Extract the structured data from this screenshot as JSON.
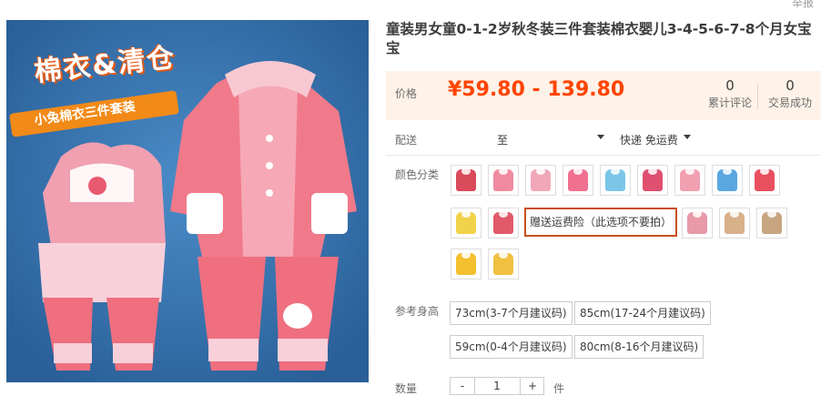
{
  "top_link": "举报",
  "image": {
    "banner_title": "棉衣&清仓",
    "banner_sub": "小兔棉衣三件套装"
  },
  "product_title": "童装男女童0-1-2岁秋冬装三件套装棉衣婴儿3-4-5-6-7-8个月女宝宝",
  "price": {
    "label": "价格",
    "value": "¥59.80 - 139.80",
    "reviews_count": "0",
    "reviews_label": "累计评论",
    "sales_count": "0",
    "sales_label": "交易成功"
  },
  "shipping": {
    "label": "配送",
    "to": "至",
    "method": "快递 免运费"
  },
  "colors": {
    "label": "颜色分类",
    "swatch_colors": [
      "#d94a5a",
      "#f08aa0",
      "#f0a8b8",
      "#f07090",
      "#7bc6e8",
      "#e05070",
      "#f0a0b0",
      "#5aa6e0",
      "#e85060",
      "#f2d24a",
      "#e05a6a",
      "#e89aa8",
      "#d8b08a",
      "#c7a580",
      "#f4c030",
      "#f0c040"
    ],
    "selected_text_option": "赠送运费险（此选项不要拍）"
  },
  "sizes": {
    "label": "参考身高",
    "options": [
      "73cm(3-7个月建议码)",
      "85cm(17-24个月建议码)",
      "59cm(0-4个月建议码)",
      "80cm(8-16个月建议码)"
    ]
  },
  "quantity": {
    "label": "数量",
    "minus": "-",
    "value": "1",
    "plus": "+",
    "note": "件"
  }
}
